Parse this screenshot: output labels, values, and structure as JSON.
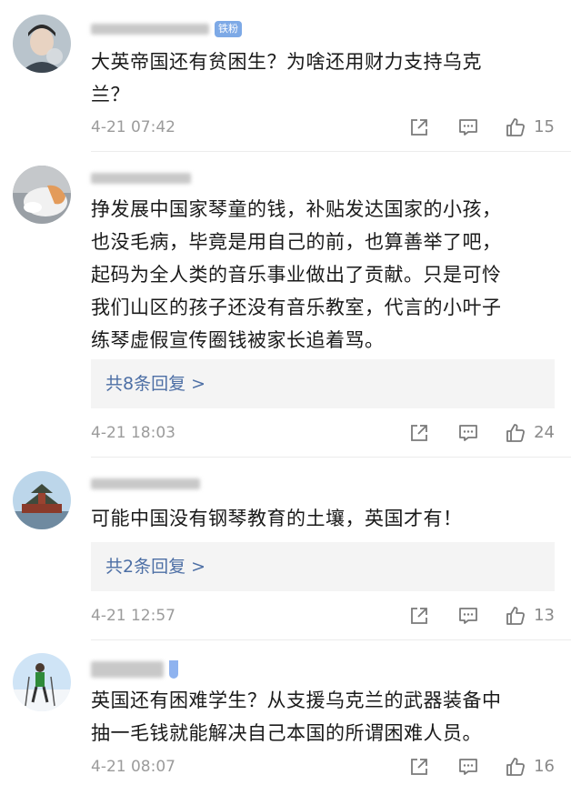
{
  "comments": [
    {
      "badge": "铁粉",
      "text": "大英帝国还有贫困生？为啥还用财力支持乌克\n兰？",
      "time": "4-21 07:42",
      "likes": "15"
    },
    {
      "text": "挣发展中国家琴童的钱，补贴发达国家的小孩，\n也没毛病，毕竟是用自己的前，也算善举了吧，\n起码为全人类的音乐事业做出了贡献。只是可怜\n我们山区的孩子还没有音乐教室，代言的小叶子\n练琴虚假宣传圈钱被家长追着骂。",
      "replies": "共8条回复 >",
      "time": "4-21 18:03",
      "likes": "24"
    },
    {
      "text": "可能中国没有钢琴教育的土壤，英国才有！",
      "replies": "共2条回复 >",
      "time": "4-21 12:57",
      "likes": "13"
    },
    {
      "text": "英国还有困难学生？从支援乌克兰的武器装备中\n抽一毛钱就能解决自己本国的所谓困难人员。",
      "time": "4-21 08:07",
      "likes": "16"
    }
  ],
  "icons": {
    "share": "share-icon",
    "reply": "comment-icon",
    "like": "thumbs-up-icon"
  },
  "colors": {
    "reply_link": "#4d6fa5",
    "meta": "#9b9b9b",
    "badge": "#7da9e6"
  }
}
